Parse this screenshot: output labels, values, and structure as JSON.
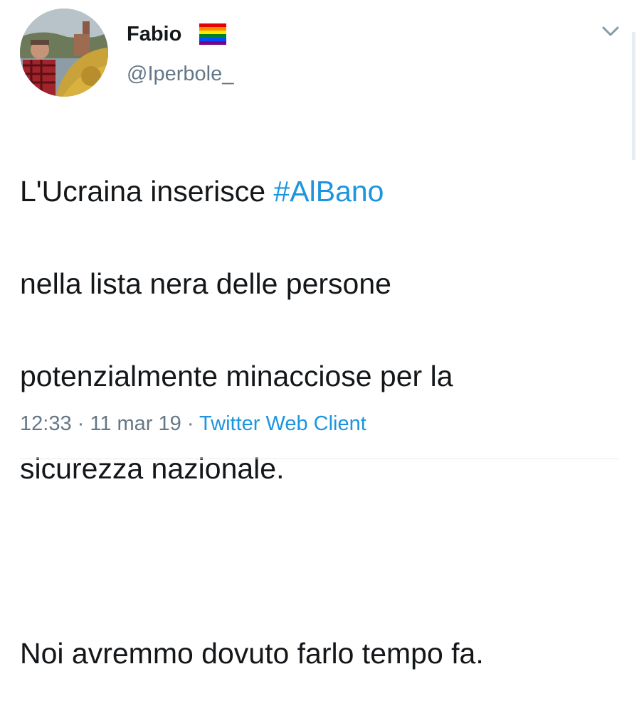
{
  "author": {
    "display_name": "Fabio",
    "handle": "@Iperbole_",
    "badge_icon": "rainbow-flag-icon"
  },
  "menu": {
    "icon": "chevron-down-icon"
  },
  "tweet": {
    "line1_prefix": "L'Ucraina inserisce ",
    "hashtag": "#AlBano",
    "line2": "nella lista nera delle persone",
    "line3": "potenzialmente minacciose per la",
    "line4": "sicurezza nazionale.",
    "line5": "Noi avremmo dovuto farlo tempo fa."
  },
  "meta": {
    "time": "12:33",
    "separator1": " · ",
    "date": "11 mar 19",
    "separator2": " · ",
    "client": "Twitter Web Client"
  },
  "colors": {
    "link": "#1b95e0",
    "secondary_text": "#657786",
    "primary_text": "#14171a"
  }
}
